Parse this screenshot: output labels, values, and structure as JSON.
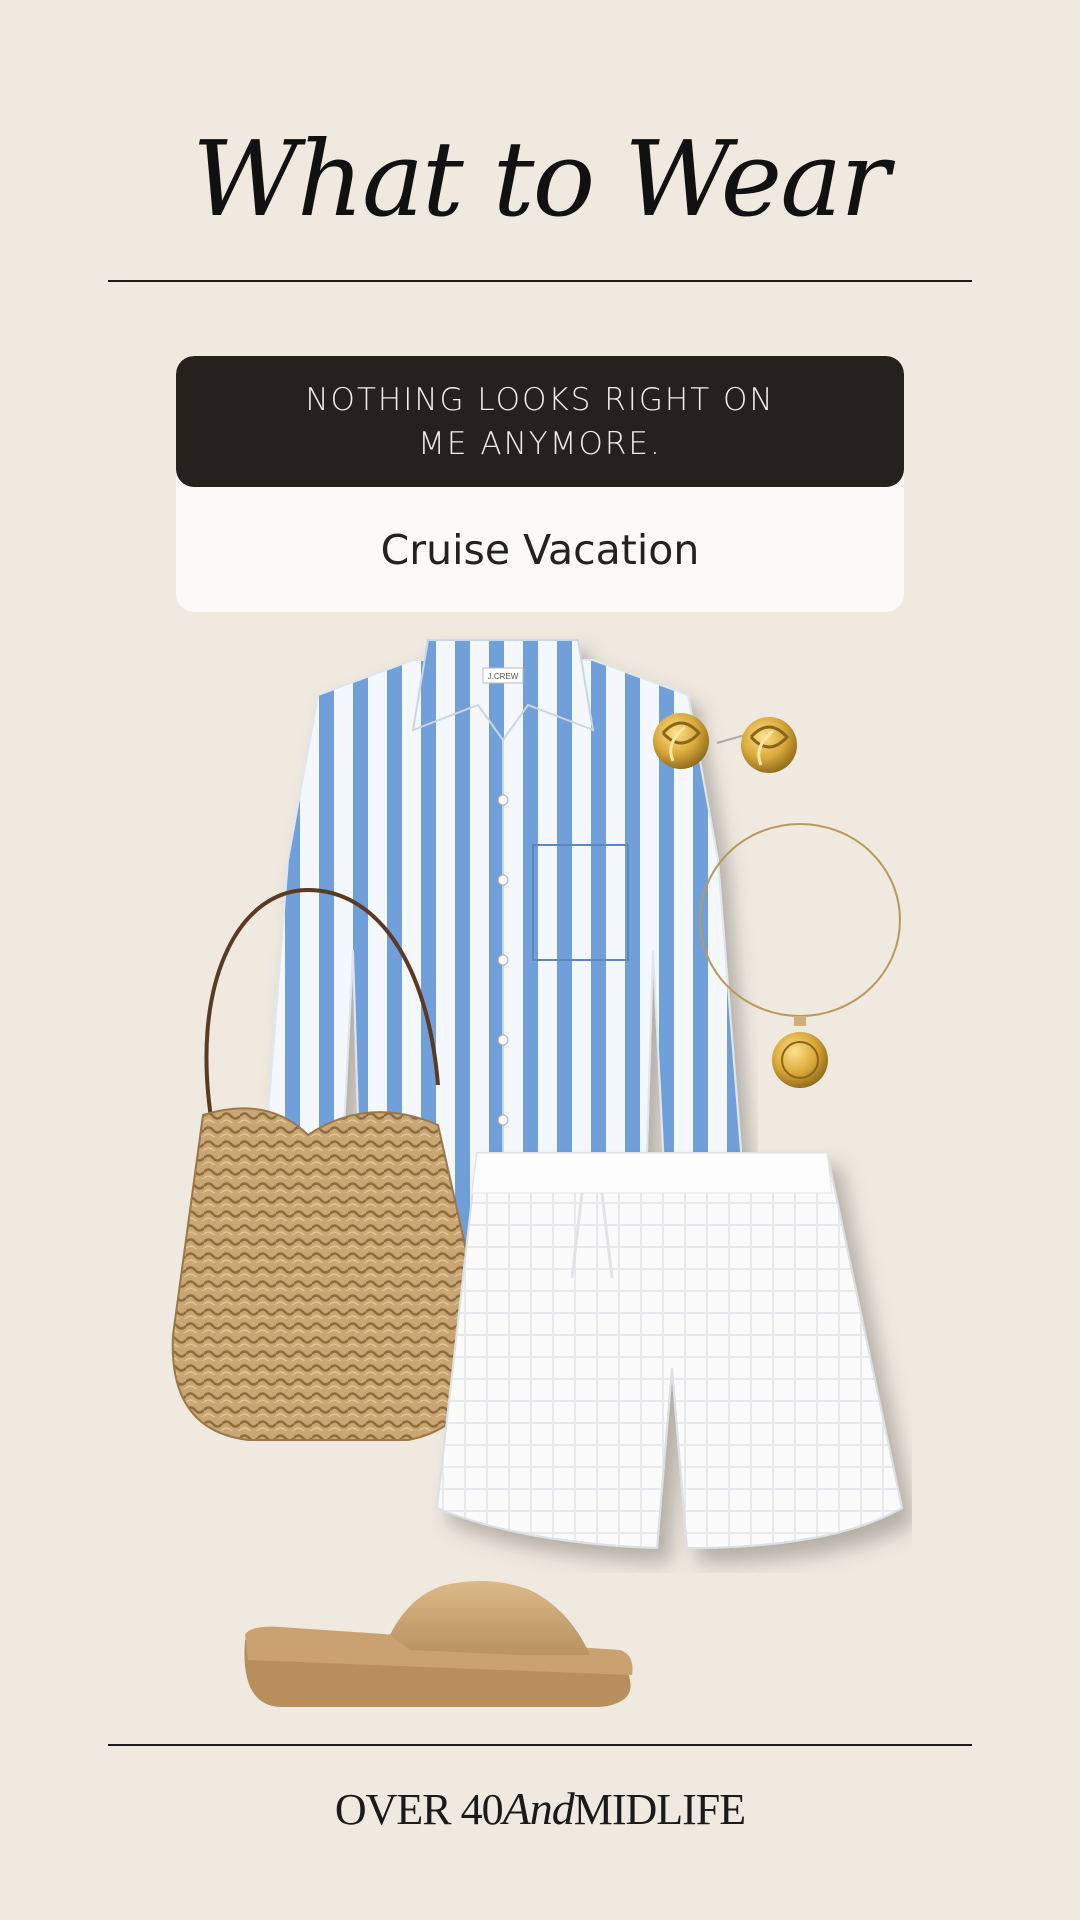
{
  "header": {
    "title": "What to Wear"
  },
  "card": {
    "headline": "NOTHING LOOKS RIGHT ON ME ANYMORE.",
    "subtitle": "Cruise Vacation"
  },
  "outfit": {
    "items": [
      {
        "name": "striped-shirt",
        "label": "J.CREW"
      },
      {
        "name": "knot-earrings"
      },
      {
        "name": "pendant-necklace"
      },
      {
        "name": "straw-tote-bag"
      },
      {
        "name": "white-shorts"
      },
      {
        "name": "slide-sandals"
      }
    ]
  },
  "footer": {
    "brand_part1": "OVER 40",
    "brand_and": "And",
    "brand_part2": "MIDLIFE"
  },
  "colors": {
    "background": "#efe9df",
    "card_dark": "#25221d",
    "card_light": "#fbfaf8",
    "shirt_blue": "#6f9fd9",
    "straw": "#c9a673",
    "gold": "#d9a93a",
    "sandal": "#c9a477"
  }
}
